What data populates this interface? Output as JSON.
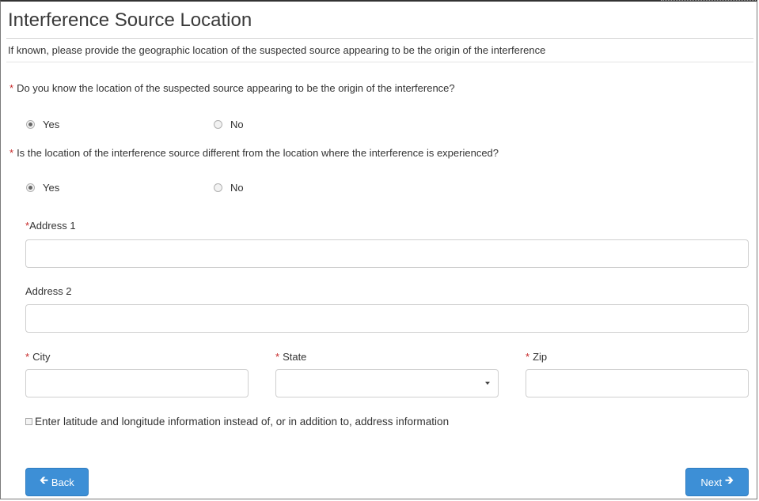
{
  "page": {
    "title": "Interference Source Location",
    "subtitle": "If known, please provide the geographic location of the suspected source appearing to be the origin of the interference"
  },
  "questions": [
    {
      "text": "Do you know the location of the suspected source appearing to be the origin of the interference?",
      "required_mark": "*",
      "options": [
        {
          "label": "Yes",
          "selected": true
        },
        {
          "label": "No",
          "selected": false
        }
      ]
    },
    {
      "text": "Is the location of the interference source different from the location where the interference is experienced?",
      "required_mark": "*",
      "options": [
        {
          "label": "Yes",
          "selected": true
        },
        {
          "label": "No",
          "selected": false
        }
      ]
    }
  ],
  "fields": {
    "address1": {
      "label": "Address 1",
      "required_mark": "*",
      "value": ""
    },
    "address2": {
      "label": "Address 2",
      "value": ""
    },
    "city": {
      "label": "City",
      "required_mark": "*",
      "value": ""
    },
    "state": {
      "label": "State",
      "required_mark": "*",
      "value": ""
    },
    "zip": {
      "label": "Zip",
      "required_mark": "*",
      "value": ""
    }
  },
  "latlong": {
    "label": "Enter latitude and longitude information instead of, or in addition to, address information",
    "checked": false
  },
  "buttons": {
    "back": {
      "label": "Back",
      "icon": "arrow-left-icon"
    },
    "next": {
      "label": "Next",
      "icon": "arrow-right-icon"
    }
  },
  "colors": {
    "required": "#c62828",
    "button_bg": "#3d8fd6"
  }
}
